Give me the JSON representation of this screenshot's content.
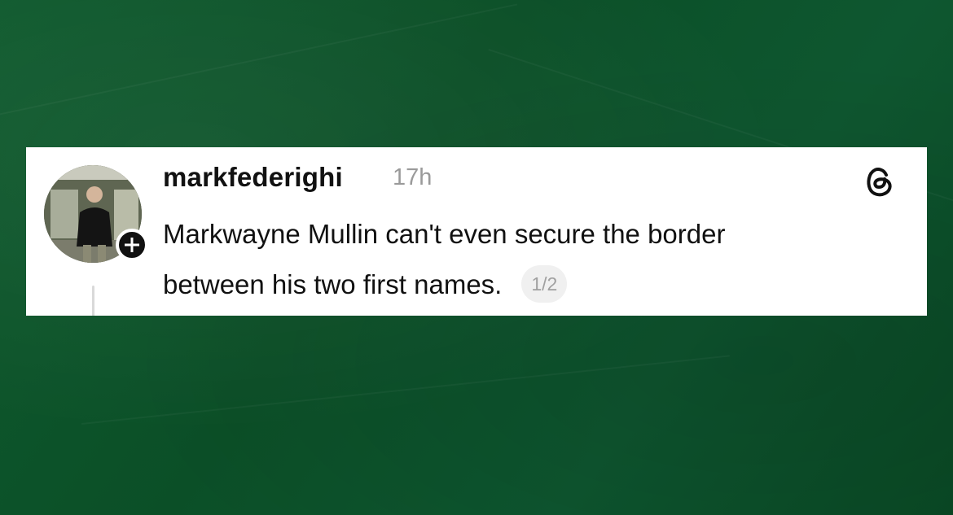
{
  "post": {
    "username": "markfederighi",
    "time_ago": "17h",
    "text_line_1": "Markwayne Mullin can't even secure the border",
    "text_line_2": "between his two first names.",
    "page_indicator": "1/2"
  },
  "icons": {
    "app_logo": "threads-logo-icon",
    "follow": "plus-icon"
  },
  "colors": {
    "background": "#0d542b",
    "card": "#ffffff",
    "text": "#111111",
    "muted": "#9a9a9a",
    "badge_bg": "#111111"
  }
}
